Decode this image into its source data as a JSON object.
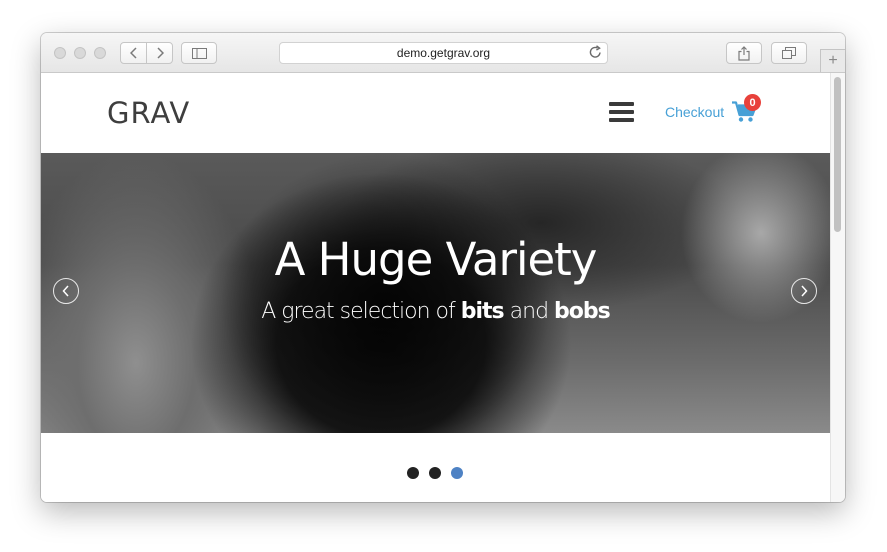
{
  "browser": {
    "url": "demo.getgrav.org",
    "new_tab_symbol": "+"
  },
  "site": {
    "logo": "GRAV",
    "checkout_label": "Checkout",
    "cart_count": "0",
    "accent_color": "#47a0d6",
    "badge_color": "#e8413b"
  },
  "hero": {
    "title": "A Huge Variety",
    "subtitle_prefix": "A great selection of ",
    "subtitle_bold1": "bits",
    "subtitle_mid": " and ",
    "subtitle_bold2": "bobs"
  },
  "slider": {
    "slide_count": 3,
    "active_slide": 3,
    "active_color": "#4e82c4"
  }
}
